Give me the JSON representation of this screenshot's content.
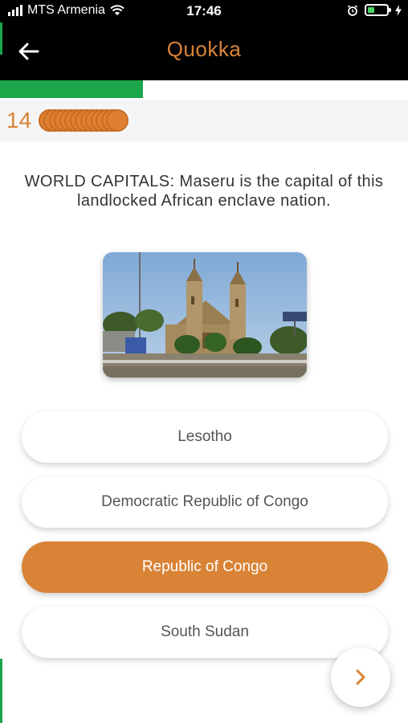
{
  "status_bar": {
    "carrier": "MTS Armenia",
    "time": "17:46",
    "battery_color": "#4cd964"
  },
  "header": {
    "title": "Quokka",
    "back_icon": "arrow-left-icon"
  },
  "progress": {
    "fraction": 0.35,
    "color": "#1ca64a"
  },
  "score": {
    "value": "14",
    "coin_count": 14,
    "accent": "#d98336"
  },
  "question": {
    "text": "WORLD CAPITALS: Maseru is the capital of this landlocked African enclave nation."
  },
  "answers": [
    {
      "label": "Lesotho",
      "selected": false
    },
    {
      "label": "Democratic Republic of Congo",
      "selected": false
    },
    {
      "label": "Republic of Congo",
      "selected": true
    },
    {
      "label": "South Sudan",
      "selected": false
    }
  ],
  "next_button": {
    "icon": "chevron-right-icon"
  }
}
